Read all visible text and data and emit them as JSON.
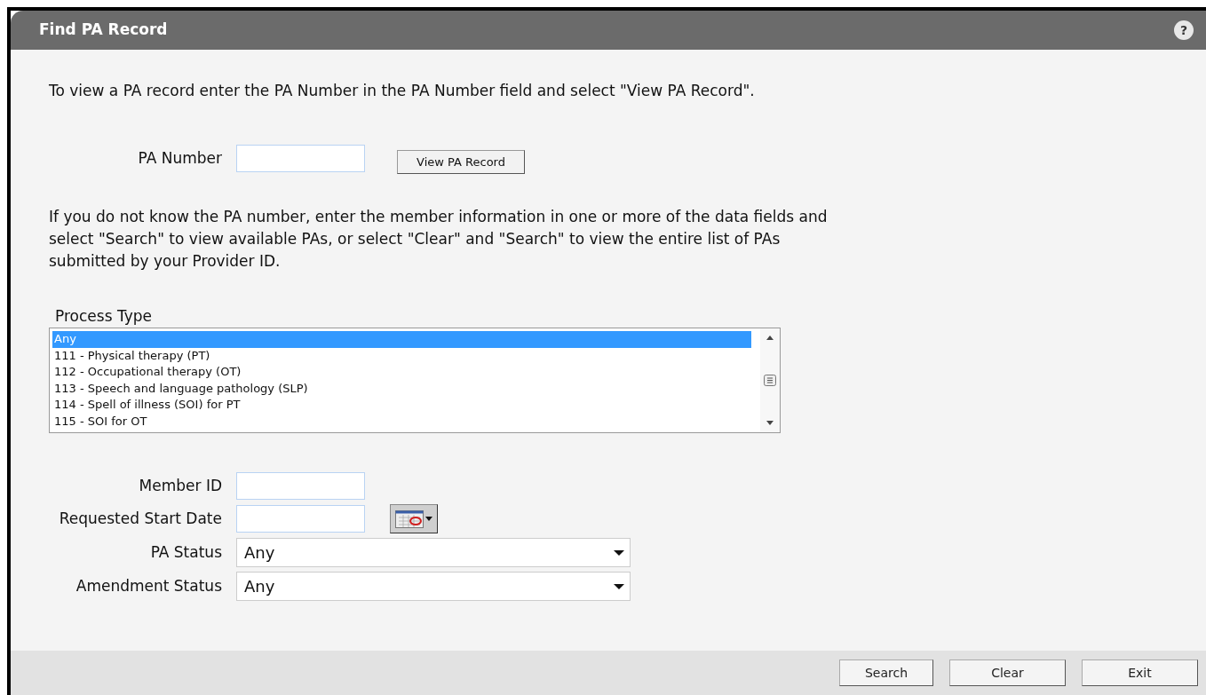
{
  "window": {
    "title": "Find PA Record",
    "help_button": "?"
  },
  "intro": "To view a PA record enter the PA Number in the PA Number field and select \"View PA Record\".",
  "pa_number": {
    "label": "PA Number",
    "button": "View PA Record"
  },
  "instructions": "If you do not know the PA number, enter the member information in one or more of the data fields and select \"Search\" to view available PAs, or select \"Clear\" and \"Search\" to view the entire list of PAs submitted by your Provider ID.",
  "process_type": {
    "label": "Process Type",
    "options": [
      {
        "text": "Any",
        "selected": true
      },
      {
        "text": "111 - Physical therapy (PT)",
        "selected": false
      },
      {
        "text": "112 - Occupational therapy (OT)",
        "selected": false
      },
      {
        "text": "113 - Speech and language pathology (SLP)",
        "selected": false
      },
      {
        "text": "114 - Spell of illness (SOI) for PT",
        "selected": false
      },
      {
        "text": "115 - SOI for OT",
        "selected": false
      }
    ]
  },
  "fields": [
    {
      "kind": "text",
      "label": "Member ID"
    },
    {
      "kind": "date",
      "label": "Requested Start Date"
    },
    {
      "kind": "select",
      "label": "PA Status",
      "value": "Any"
    },
    {
      "kind": "select",
      "label": "Amendment Status",
      "value": "Any"
    }
  ],
  "buttons": [
    "Search",
    "Clear",
    "Exit"
  ]
}
